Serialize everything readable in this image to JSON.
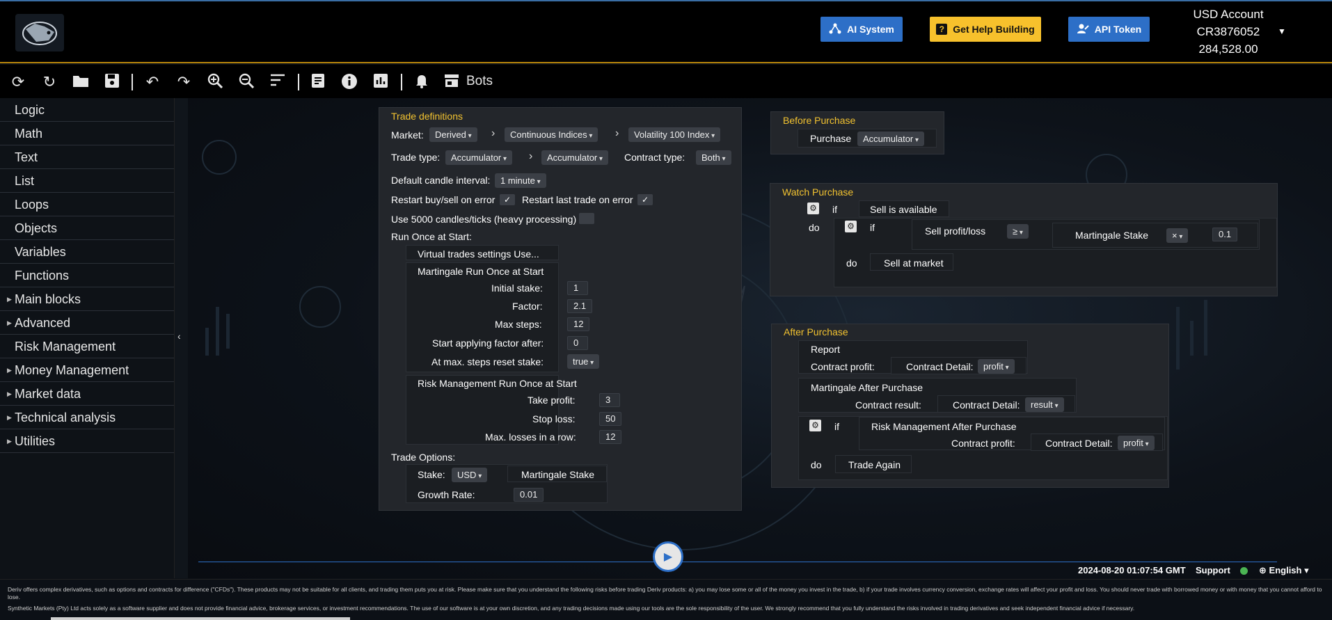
{
  "header": {
    "buttons": {
      "ai_system": "AI System",
      "get_help": "Get Help Building",
      "api_token": "API Token"
    },
    "account": {
      "currency_label": "USD Account",
      "id": "CR3876052",
      "balance": "284,528.00"
    }
  },
  "toolbar": {
    "bots_label": "Bots"
  },
  "sidebar": {
    "items": [
      {
        "label": "Logic",
        "expandable": false
      },
      {
        "label": "Math",
        "expandable": false
      },
      {
        "label": "Text",
        "expandable": false
      },
      {
        "label": "List",
        "expandable": false
      },
      {
        "label": "Loops",
        "expandable": false
      },
      {
        "label": "Objects",
        "expandable": false
      },
      {
        "label": "Variables",
        "expandable": false
      },
      {
        "label": "Functions",
        "expandable": false
      },
      {
        "label": "Main blocks",
        "expandable": true
      },
      {
        "label": "Advanced",
        "expandable": true
      },
      {
        "label": "Risk Management",
        "expandable": false
      },
      {
        "label": "Money Management",
        "expandable": true
      },
      {
        "label": "Market data",
        "expandable": true
      },
      {
        "label": "Technical analysis",
        "expandable": true
      },
      {
        "label": "Utilities",
        "expandable": true
      }
    ]
  },
  "trade_definitions": {
    "title": "Trade definitions",
    "market_label": "Market:",
    "market": [
      "Derived",
      "Continuous Indices",
      "Volatility 100 Index"
    ],
    "trade_type_label": "Trade type:",
    "trade_type": [
      "Accumulator",
      "Accumulator"
    ],
    "contract_type_label": "Contract type:",
    "contract_type": "Both",
    "candle_interval_label": "Default candle interval:",
    "candle_interval": "1 minute",
    "restart_buy_sell_label": "Restart buy/sell on error",
    "restart_last_trade_label": "Restart last trade on error",
    "use_5000_label": "Use 5000 candles/ticks (heavy processing)",
    "check_mark": "✓",
    "run_once_label": "Run Once at Start:",
    "virtual_trades": "Virtual trades settings Use...",
    "martingale": {
      "title": "Martingale Run Once at Start",
      "initial_stake_label": "Initial stake:",
      "initial_stake": "1",
      "factor_label": "Factor:",
      "factor": "2.1",
      "max_steps_label": "Max steps:",
      "max_steps": "12",
      "start_applying_label": "Start applying factor after:",
      "start_applying": "0",
      "at_max_steps_label": "At max. steps reset stake:",
      "at_max_steps": "true"
    },
    "risk": {
      "title": "Risk Management Run Once at Start",
      "take_profit_label": "Take profit:",
      "take_profit": "3",
      "stop_loss_label": "Stop loss:",
      "stop_loss": "50",
      "max_losses_label": "Max. losses in a row:",
      "max_losses": "12"
    },
    "trade_options_label": "Trade Options:",
    "stake_label": "Stake:",
    "stake_currency": "USD",
    "stake_value": "Martingale Stake",
    "growth_rate_label": "Growth Rate:",
    "growth_rate": "0.01"
  },
  "before_purchase": {
    "title": "Before Purchase",
    "purchase_label": "Purchase",
    "purchase_type": "Accumulator"
  },
  "watch_purchase": {
    "title": "Watch Purchase",
    "if_label": "if",
    "do_label": "do",
    "sell_available": "Sell is available",
    "sell_profit_loss": "Sell profit/loss",
    "operator": "≥",
    "martingale_stake": "Martingale Stake",
    "math_op": "×",
    "multiplier": "0.1",
    "sell_at_market": "Sell at market"
  },
  "after_purchase": {
    "title": "After Purchase",
    "report": "Report",
    "contract_profit_label": "Contract profit:",
    "contract_detail_label": "Contract Detail:",
    "profit": "profit",
    "martingale_after": "Martingale After Purchase",
    "contract_result_label": "Contract result:",
    "result": "result",
    "if_label": "if",
    "do_label": "do",
    "risk_after": "Risk Management After Purchase",
    "trade_again": "Trade Again"
  },
  "status_bar": {
    "timestamp": "2024-08-20 01:07:54 GMT",
    "support": "Support",
    "language": "English"
  },
  "footer": {
    "disclaimer_1": "Deriv offers complex derivatives, such as options and contracts for difference (\"CFDs\"). These products may not be suitable for all clients, and trading them puts you at risk. Please make sure that you understand the following risks before trading Deriv products: a) you may lose some or all of the money you invest in the trade, b) if your trade involves currency conversion, exchange rates will affect your profit and loss. You should never trade with borrowed money or with money that you cannot afford to lose.",
    "disclaimer_2": "Synthetic Markets (Pty) Ltd acts solely as a software supplier and does not provide financial advice, brokerage services, or investment recommendations. The use of our software is at your own discretion, and any trading decisions made using our tools are the sole responsibility of the user. We strongly recommend that you fully understand the risks involved in trading derivatives and seek independent financial advice if necessary."
  }
}
